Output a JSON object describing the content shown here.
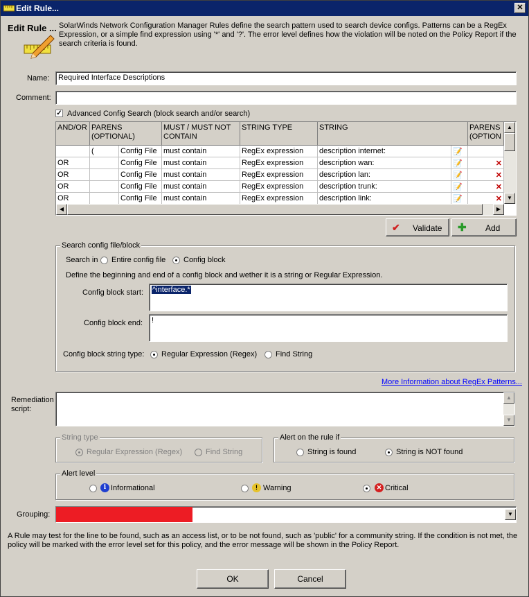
{
  "window": {
    "title": "Edit Rule..."
  },
  "header": {
    "title": "Edit Rule ...",
    "description": "SolarWinds Network Configuration Manager Rules define the search pattern used to search device configs.  Patterns can be a RegEx Expression, or a simple find expression using '*' and '?'.  The error level defines how the violation will be noted on the Policy Report if the search criteria is found."
  },
  "form": {
    "name_label": "Name:",
    "name_value": "Required Interface Descriptions",
    "comment_label": "Comment:",
    "comment_value": "",
    "advanced_label": "Advanced Config Search (block search and/or search)"
  },
  "grid": {
    "headers": [
      "AND/OR",
      "PARENS (OPTIONAL)",
      "",
      "MUST / MUST NOT CONTAIN",
      "STRING TYPE",
      "STRING",
      "",
      "PARENS (OPTION"
    ],
    "rows": [
      {
        "andor": "",
        "parens": "(",
        "source": "Config File",
        "must": "must contain",
        "type": "RegEx expression",
        "string": "description internet:"
      },
      {
        "andor": "OR",
        "parens": "",
        "source": "Config File",
        "must": "must contain",
        "type": "RegEx expression",
        "string": "description wan:"
      },
      {
        "andor": "OR",
        "parens": "",
        "source": "Config File",
        "must": "must contain",
        "type": "RegEx expression",
        "string": "description lan:"
      },
      {
        "andor": "OR",
        "parens": "",
        "source": "Config File",
        "must": "must contain",
        "type": "RegEx expression",
        "string": "description trunk:"
      },
      {
        "andor": "OR",
        "parens": "",
        "source": "Config File",
        "must": "must contain",
        "type": "RegEx expression",
        "string": "description link:"
      }
    ]
  },
  "buttons": {
    "validate": "Validate",
    "add": "Add",
    "ok": "OK",
    "cancel": "Cancel"
  },
  "search_config": {
    "legend": "Search config file/block",
    "search_in_label": "Search in",
    "opt_entire": "Entire config file",
    "opt_block": "Config block",
    "define_text": "Define the beginning and end of a config block and wether it is a string or Regular Expression.",
    "block_start_label": "Config block start:",
    "block_start_value": "^interface.*",
    "block_end_label": "Config block end:",
    "block_end_value": "!",
    "string_type_label": "Config block string type:",
    "opt_regex": "Regular Expression (Regex)",
    "opt_find": "Find String"
  },
  "more_info_link": "More Information about RegEx Patterns...",
  "remediation": {
    "label": "Remediation script:",
    "value": ""
  },
  "string_type": {
    "legend": "String type",
    "opt_regex": "Regular Expression (Regex)",
    "opt_find": "Find String"
  },
  "alert_rule": {
    "legend": "Alert on the rule if",
    "opt_found": "String is found",
    "opt_not_found": "String is NOT found"
  },
  "alert_level": {
    "legend": "Alert level",
    "opt_info": "Informational",
    "opt_warning": "Warning",
    "opt_critical": "Critical"
  },
  "grouping": {
    "label": "Grouping:",
    "value": ""
  },
  "footer_note": "A Rule may test for the line to be found, such as an access list, or to be not found, such as 'public' for a community string.  If the condition is not met, the policy will be marked with the error level set for this policy, and the error message will be shown in the Policy Report.",
  "colors": {
    "titlebar": "#0a246a",
    "redaction": "#ed1c24",
    "info_blue": "#1f3fd0",
    "warning_yellow": "#e6c229",
    "critical_red": "#d42020"
  }
}
